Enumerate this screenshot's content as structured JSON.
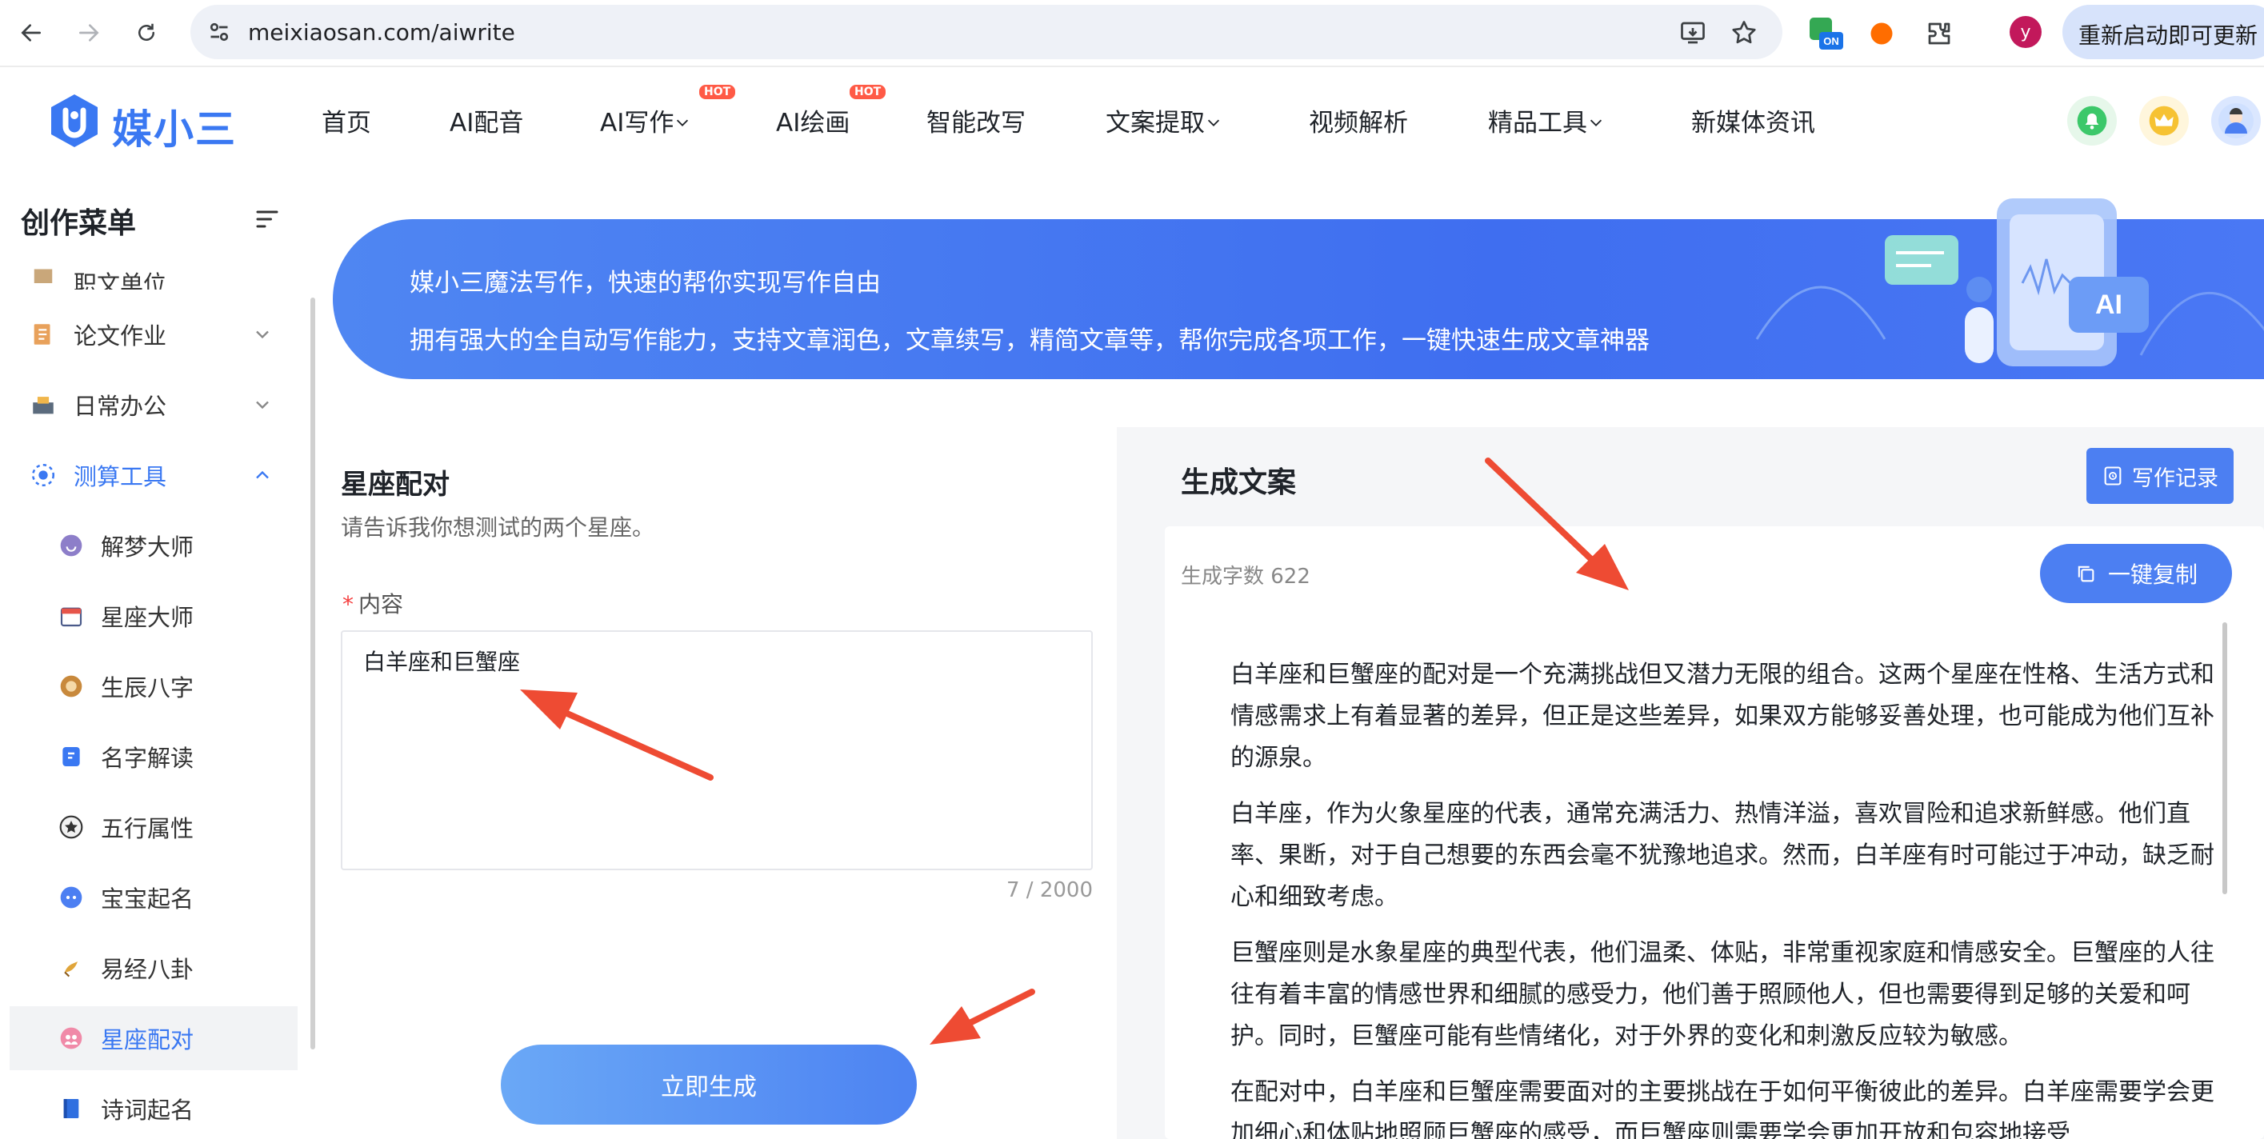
{
  "browser": {
    "url": "meixiaosan.com/aiwrite",
    "profile_initial": "y",
    "update_label": "重新启动即可更新",
    "ext_badge": "ON"
  },
  "header": {
    "logo_text": "媒小三",
    "nav": [
      "首页",
      "AI配音",
      "AI写作",
      "AI绘画",
      "智能改写",
      "文案提取",
      "视频解析",
      "精品工具",
      "新媒体资讯"
    ],
    "hot_badge": "HOT"
  },
  "sidebar": {
    "title": "创作菜单",
    "cut_item": "职文单位",
    "groups": [
      {
        "label": "论文作业"
      },
      {
        "label": "日常办公"
      },
      {
        "label": "测算工具"
      }
    ],
    "subitems": [
      "解梦大师",
      "星座大师",
      "生辰八字",
      "名字解读",
      "五行属性",
      "宝宝起名",
      "易经八卦",
      "星座配对",
      "诗词起名"
    ]
  },
  "banner": {
    "line1": "媒小三魔法写作，快速的帮你实现写作自由",
    "line2": "拥有强大的全自动写作能力，支持文章润色，文章续写，精简文章等，帮你完成各项工作，一键快速生成文章神器",
    "art_label": "AI"
  },
  "form": {
    "title": "星座配对",
    "description": "请告诉我你想测试的两个星座。",
    "required_mark": "*",
    "field_label": "内容",
    "value": "白羊座和巨蟹座",
    "counter": "7 / 2000",
    "generate_label": "立即生成"
  },
  "output": {
    "title": "生成文案",
    "record_label": "写作记录",
    "word_count": "生成字数 622",
    "copy_label": "一键复制",
    "paragraphs": [
      "白羊座和巨蟹座的配对是一个充满挑战但又潜力无限的组合。这两个星座在性格、生活方式和情感需求上有着显著的差异，但正是这些差异，如果双方能够妥善处理，也可能成为他们互补的源泉。",
      "白羊座，作为火象星座的代表，通常充满活力、热情洋溢，喜欢冒险和追求新鲜感。他们直率、果断，对于自己想要的东西会毫不犹豫地追求。然而，白羊座有时可能过于冲动，缺乏耐心和细致考虑。",
      "巨蟹座则是水象星座的典型代表，他们温柔、体贴，非常重视家庭和情感安全。巨蟹座的人往往有着丰富的情感世界和细腻的感受力，他们善于照顾他人，但也需要得到足够的关爱和呵护。同时，巨蟹座可能有些情绪化，对于外界的变化和刺激反应较为敏感。",
      "在配对中，白羊座和巨蟹座需要面对的主要挑战在于如何平衡彼此的差异。白羊座需要学会更加细心和体贴地照顾巨蟹座的感受，而巨蟹座则需要学会更加开放和包容地接受"
    ]
  },
  "colors": {
    "accent": "#3a78f2",
    "banner": "#4a78f4",
    "annotation_arrow": "#ee4b33"
  }
}
